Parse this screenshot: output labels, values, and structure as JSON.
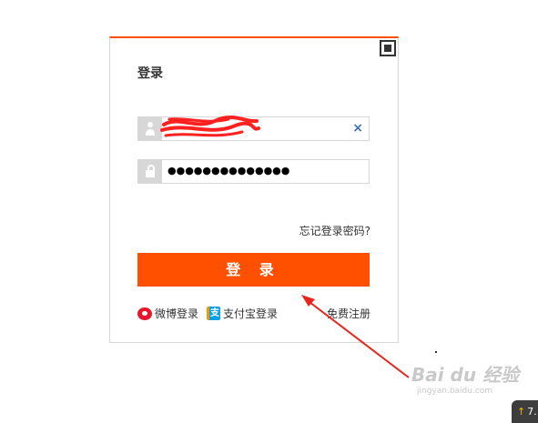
{
  "login": {
    "title": "登录",
    "username_value": "",
    "password_value": "●●●●●●●●●●●●●●",
    "clear_symbol": "×",
    "forgot_label": "忘记登录密码?",
    "submit_label": "登 录",
    "weibo_label": "微博登录",
    "alipay_label": "支付宝登录",
    "alipay_badge": "支",
    "register_label": "免费注册"
  },
  "watermark": {
    "text": "Bai du 经验",
    "sub": "jingyan.baidu.com"
  },
  "badge": {
    "arrow": "↑",
    "text": "7."
  },
  "colors": {
    "accent": "#ff5000",
    "annotation": "#e8251c",
    "clear": "#3b6fb6"
  },
  "icons": [
    "qr-code-icon",
    "user-icon",
    "lock-icon",
    "clear-icon",
    "weibo-icon",
    "alipay-icon",
    "arrow-annotation-icon"
  ]
}
